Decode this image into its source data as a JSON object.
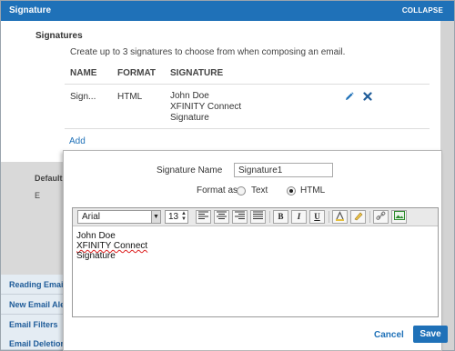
{
  "header": {
    "title": "Signature",
    "collapse_label": "COLLAPSE"
  },
  "section": {
    "title": "Signatures",
    "description": "Create up to 3 signatures to choose from when composing an email.",
    "columns": [
      "NAME",
      "FORMAT",
      "SIGNATURE"
    ],
    "row": {
      "name": "Sign...",
      "format": "HTML",
      "signature_lines": [
        "John Doe",
        "XFINITY Connect",
        "Signature"
      ]
    },
    "add_label": "Add"
  },
  "background": {
    "default_label": "Default A",
    "small_label": "E"
  },
  "nav": [
    "Reading Email",
    "New Email Alert",
    "Email Filters",
    "Email Deletion S"
  ],
  "dialog": {
    "name_label": "Signature Name",
    "name_value": "Signature1",
    "format_label": "Format as",
    "format_text": "Text",
    "format_html": "HTML",
    "selected_format": "HTML",
    "toolbar": {
      "font": "Arial",
      "size": "13"
    },
    "body_lines": [
      "John Doe",
      "XFINITY Connect",
      "Signature"
    ],
    "cancel_label": "Cancel",
    "save_label": "Save"
  },
  "colors": {
    "accent": "#1f71b8",
    "nav_bg": "#e4ecf3",
    "background_gray": "#d9d9d9"
  }
}
